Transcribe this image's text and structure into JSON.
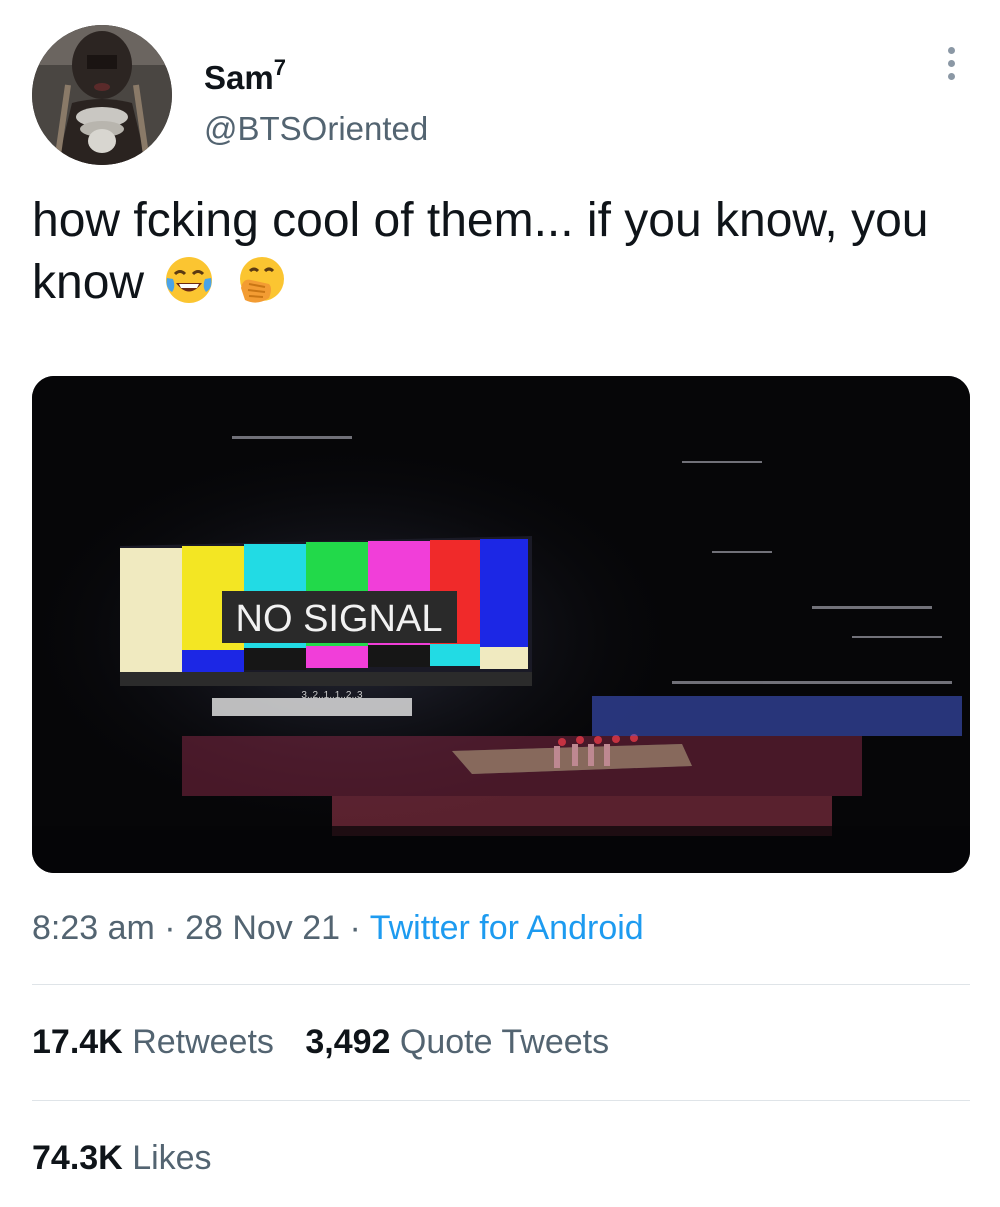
{
  "user": {
    "display_name": "Sam",
    "display_name_sup": "7",
    "handle": "@BTSOriented"
  },
  "tweet": {
    "text": "how fcking cool of them... if you know, you know",
    "emojis": [
      "face-with-tears-of-joy",
      "face-with-hand-over-mouth"
    ]
  },
  "media": {
    "screen_text": "NO SIGNAL",
    "screen_small_text": "3..2..1..1..2..3"
  },
  "meta": {
    "time": "8:23 am",
    "sep1": " · ",
    "date": "28 Nov 21",
    "sep2": " · ",
    "source": "Twitter for Android"
  },
  "stats": {
    "retweets_count": "17.4K",
    "retweets_label": "Retweets",
    "quotes_count": "3,492",
    "quotes_label": "Quote Tweets",
    "likes_count": "74.3K",
    "likes_label": "Likes"
  },
  "colors": {
    "link": "#1d9bf0",
    "secondary_text": "#536471",
    "primary_text": "#0f1419",
    "divider": "#dfe4e8"
  }
}
